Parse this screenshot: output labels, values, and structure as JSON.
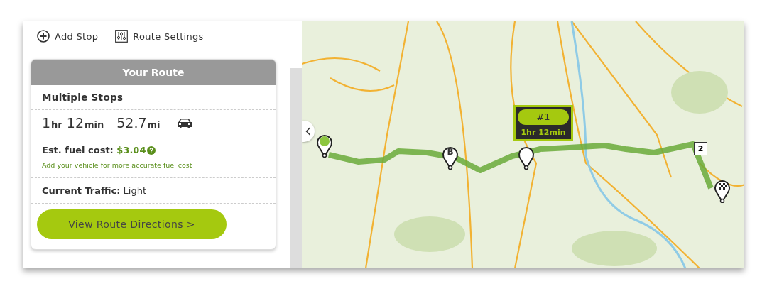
{
  "toolbar": [
    {
      "kind": "add",
      "label": "Add Stop"
    },
    {
      "kind": "settings",
      "label": "Route Settings"
    }
  ],
  "route_card": {
    "title": "Your Route",
    "route_type": "Multiple Stops",
    "duration": [
      {
        "value": "1",
        "unit": "hr"
      },
      {
        "value": "12",
        "unit": "min"
      }
    ],
    "distance": {
      "value": "52.7",
      "unit": "mi"
    },
    "fuel_label": "Est. fuel cost:",
    "fuel_value": "$3.04",
    "fuel_note": "Add your vehicle for more accurate fuel cost",
    "traffic": "**Current Traffic:** Light",
    "directions_button": "View Route Directions >"
  },
  "map": {
    "popup": {
      "badge": "#1",
      "duration": "1hr 12min"
    },
    "markers": [
      {
        "kind": "start"
      },
      {
        "kind": "letter",
        "label": "B"
      },
      {
        "kind": "via"
      },
      {
        "kind": "finish"
      }
    ],
    "route_shield": "2"
  }
}
